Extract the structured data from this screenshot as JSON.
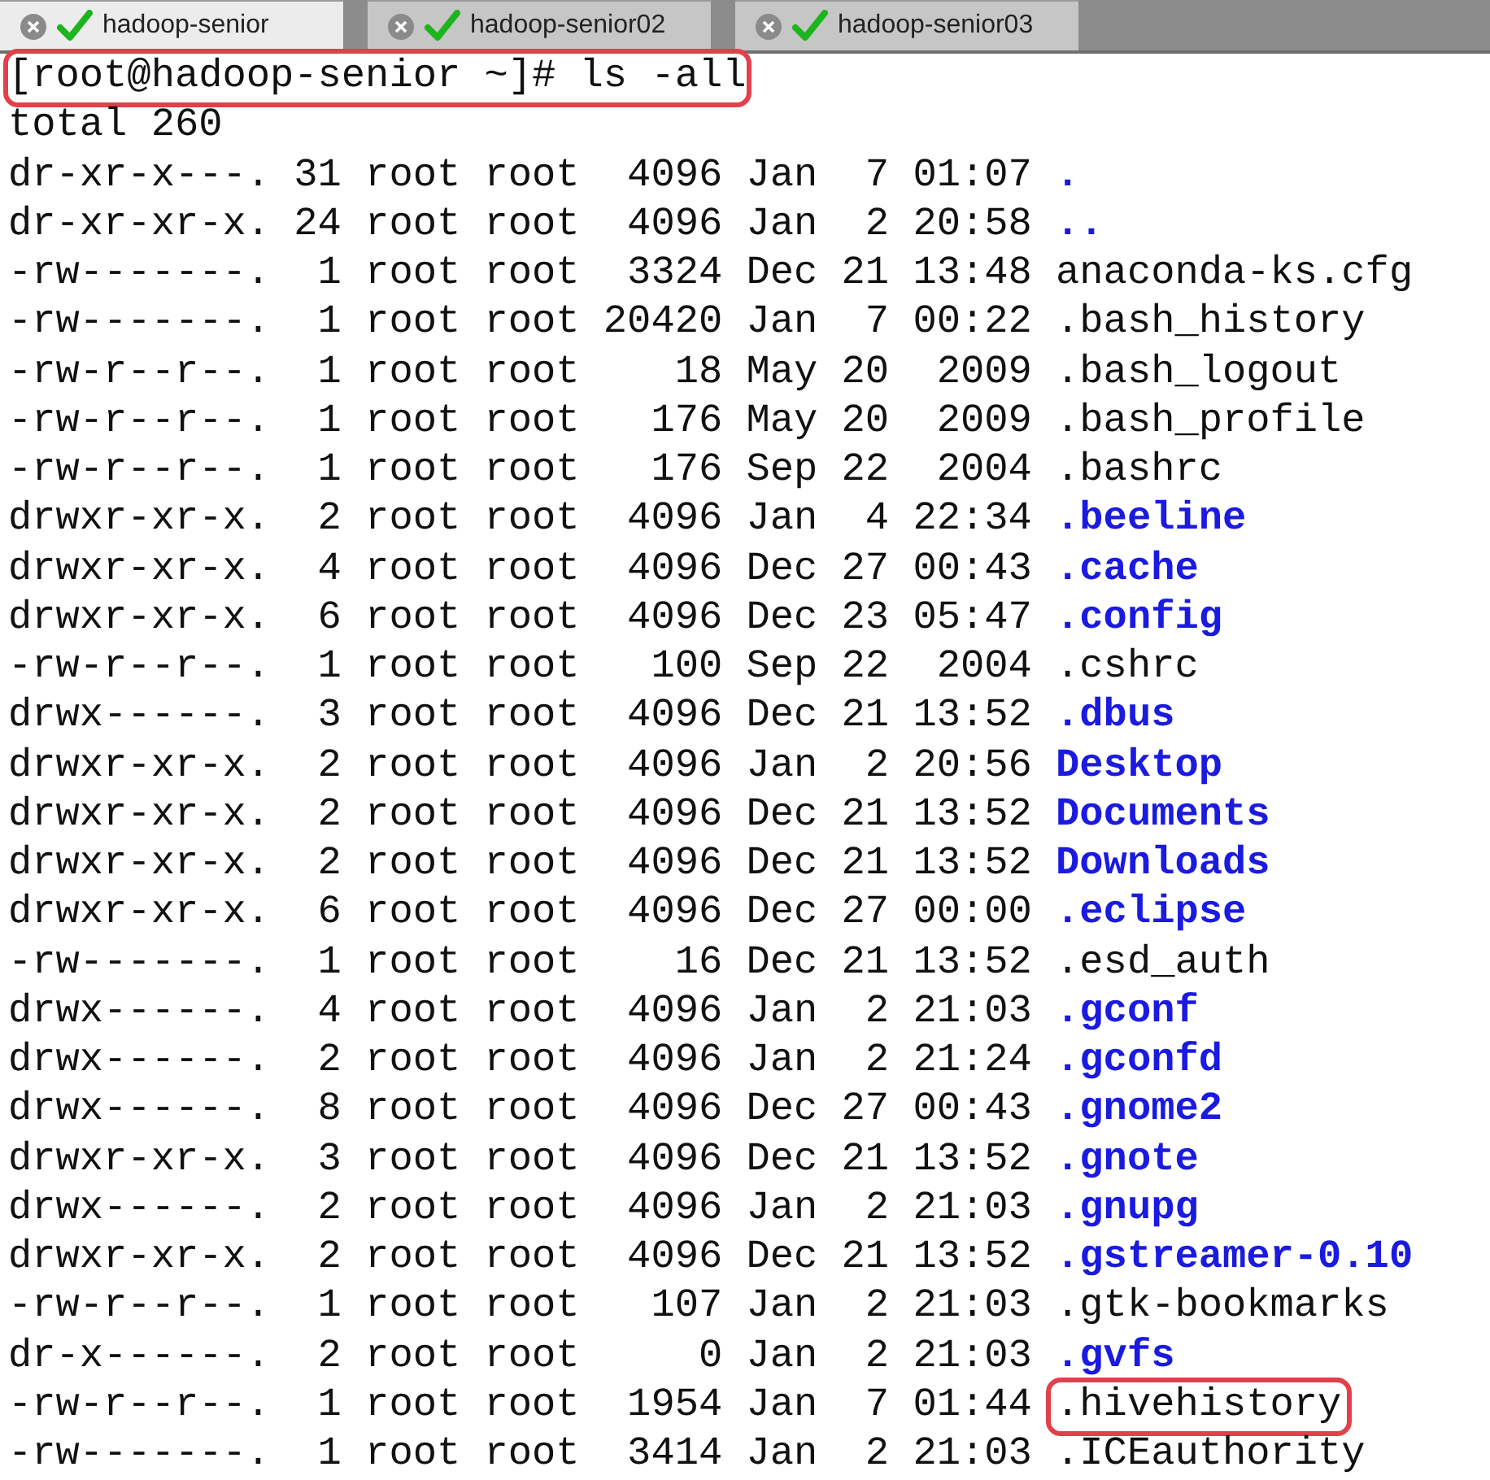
{
  "tabs": [
    {
      "label": "hadoop-senior",
      "selected": true
    },
    {
      "label": "hadoop-senior02",
      "selected": false
    },
    {
      "label": "hadoop-senior03",
      "selected": false
    }
  ],
  "terminal": {
    "prompt": {
      "text": "[root@hadoop-senior ~]# ls -all",
      "highlighted": true
    },
    "total": "total 260",
    "entries": [
      {
        "info": "dr-xr-x---. 31 root root  4096 Jan  7 01:07",
        "name": ".",
        "kind": "dir",
        "highlighted": false
      },
      {
        "info": "dr-xr-xr-x. 24 root root  4096 Jan  2 20:58",
        "name": "..",
        "kind": "dir",
        "highlighted": false
      },
      {
        "info": "-rw-------.  1 root root  3324 Dec 21 13:48",
        "name": "anaconda-ks.cfg",
        "kind": "file",
        "highlighted": false
      },
      {
        "info": "-rw-------.  1 root root 20420 Jan  7 00:22",
        "name": ".bash_history",
        "kind": "file",
        "highlighted": false
      },
      {
        "info": "-rw-r--r--.  1 root root    18 May 20  2009",
        "name": ".bash_logout",
        "kind": "file",
        "highlighted": false
      },
      {
        "info": "-rw-r--r--.  1 root root   176 May 20  2009",
        "name": ".bash_profile",
        "kind": "file",
        "highlighted": false
      },
      {
        "info": "-rw-r--r--.  1 root root   176 Sep 22  2004",
        "name": ".bashrc",
        "kind": "file",
        "highlighted": false
      },
      {
        "info": "drwxr-xr-x.  2 root root  4096 Jan  4 22:34",
        "name": ".beeline",
        "kind": "dir",
        "highlighted": false
      },
      {
        "info": "drwxr-xr-x.  4 root root  4096 Dec 27 00:43",
        "name": ".cache",
        "kind": "dir",
        "highlighted": false
      },
      {
        "info": "drwxr-xr-x.  6 root root  4096 Dec 23 05:47",
        "name": ".config",
        "kind": "dir",
        "highlighted": false
      },
      {
        "info": "-rw-r--r--.  1 root root   100 Sep 22  2004",
        "name": ".cshrc",
        "kind": "file",
        "highlighted": false
      },
      {
        "info": "drwx------.  3 root root  4096 Dec 21 13:52",
        "name": ".dbus",
        "kind": "dir",
        "highlighted": false
      },
      {
        "info": "drwxr-xr-x.  2 root root  4096 Jan  2 20:56",
        "name": "Desktop",
        "kind": "dir",
        "highlighted": false
      },
      {
        "info": "drwxr-xr-x.  2 root root  4096 Dec 21 13:52",
        "name": "Documents",
        "kind": "dir",
        "highlighted": false
      },
      {
        "info": "drwxr-xr-x.  2 root root  4096 Dec 21 13:52",
        "name": "Downloads",
        "kind": "dir",
        "highlighted": false
      },
      {
        "info": "drwxr-xr-x.  6 root root  4096 Dec 27 00:00",
        "name": ".eclipse",
        "kind": "dir",
        "highlighted": false
      },
      {
        "info": "-rw-------.  1 root root    16 Dec 21 13:52",
        "name": ".esd_auth",
        "kind": "file",
        "highlighted": false
      },
      {
        "info": "drwx------.  4 root root  4096 Jan  2 21:03",
        "name": ".gconf",
        "kind": "dir",
        "highlighted": false
      },
      {
        "info": "drwx------.  2 root root  4096 Jan  2 21:24",
        "name": ".gconfd",
        "kind": "dir",
        "highlighted": false
      },
      {
        "info": "drwx------.  8 root root  4096 Dec 27 00:43",
        "name": ".gnome2",
        "kind": "dir",
        "highlighted": false
      },
      {
        "info": "drwxr-xr-x.  3 root root  4096 Dec 21 13:52",
        "name": ".gnote",
        "kind": "dir",
        "highlighted": false
      },
      {
        "info": "drwx------.  2 root root  4096 Jan  2 21:03",
        "name": ".gnupg",
        "kind": "dir",
        "highlighted": false
      },
      {
        "info": "drwxr-xr-x.  2 root root  4096 Dec 21 13:52",
        "name": ".gstreamer-0.10",
        "kind": "dir",
        "highlighted": false
      },
      {
        "info": "-rw-r--r--.  1 root root   107 Jan  2 21:03",
        "name": ".gtk-bookmarks",
        "kind": "file",
        "highlighted": false
      },
      {
        "info": "dr-x------.  2 root root     0 Jan  2 21:03",
        "name": ".gvfs",
        "kind": "dir",
        "highlighted": false
      },
      {
        "info": "-rw-r--r--.  1 root root  1954 Jan  7 01:44",
        "name": ".hivehistory",
        "kind": "file",
        "highlighted": true
      },
      {
        "info": "-rw-------.  1 root root  3414 Jan  2 21:03",
        "name": ".ICEauthority",
        "kind": "file",
        "highlighted": false
      }
    ]
  }
}
